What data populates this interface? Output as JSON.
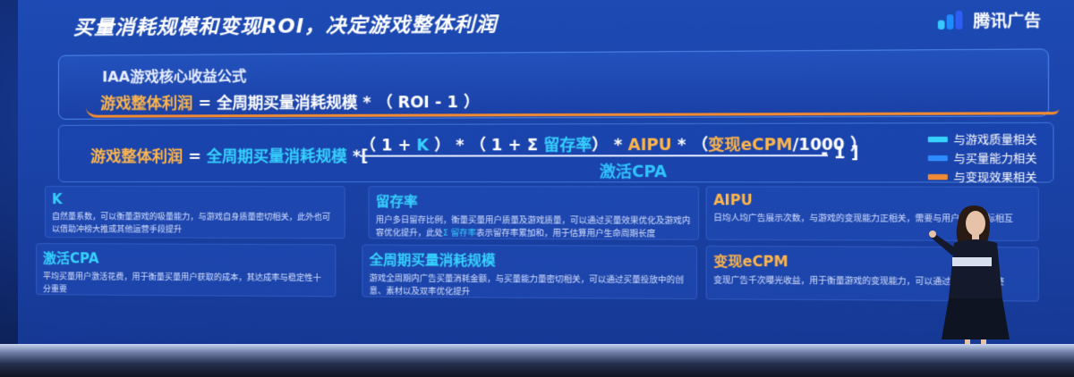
{
  "slide": {
    "title": "买量消耗规模和变现ROI，决定游戏整体利润",
    "brand_name": "腾讯广告",
    "brand_colors": [
      "#36c8ff",
      "#1f8bff",
      "#2f5ef2"
    ],
    "formula_box": {
      "heading": "IAA游戏核心收益公式",
      "lhs": "游戏整体利润",
      "rhs": "= 全周期买量消耗规模 * （ ROI - 1 ）"
    },
    "expanded_formula": {
      "lhs": "游戏整体利润",
      "eq": " = ",
      "scale": "全周期买量消耗规模",
      "open": " *[",
      "num_1": "（ 1 + ",
      "k": "K",
      "num_2": " ） * （ 1 + Σ ",
      "retention": "留存率",
      "num_3": "） * ",
      "aipu": "AIPU",
      "num_4": " * （",
      "ecpm": "变现eCPM",
      "num_5": "/1000 ）",
      "denominator": "激活CPA",
      "tail": "- 1 ]"
    },
    "legend": [
      {
        "label": "与游戏质量相关",
        "color": "#36d2ff"
      },
      {
        "label": "与买量能力相关",
        "color": "#2f8cff"
      },
      {
        "label": "与变现效果相关",
        "color": "#f08a33"
      }
    ],
    "cards": [
      {
        "title": "K",
        "text": "自然量系数，可以衡量游戏的吸量能力，与游戏自身质量密切相关，此外也可以借助冲榜大推或其他运营手段提升"
      },
      {
        "title": "留存率",
        "text_1": "用户多日留存比例，衡量买量用户质量及游戏质量，可以通过买量效果优化及游戏内容优化提升，此处",
        "highlight": "Σ 留存率",
        "text_2": "表示留存率累加和，用于估算用户生命周期长度"
      },
      {
        "title": "AIPU",
        "text": "日均人均广告展示次数，与游戏的变现能力正相关，需要与用户体验指标相互"
      },
      {
        "title": "激活CPA",
        "text": "平均买量用户激活花费，用于衡量买量用户获取的成本，其达成率与稳定性十分重要"
      },
      {
        "title": "全周期买量消耗规模",
        "text": "游戏全周期内广告买量消耗金额，与买量能力量密切相关，可以通过买量投放中的创意、素材以及双率优化提升"
      },
      {
        "title": "变现eCPM",
        "text": "变现广告千次曝光收益，用于衡量游戏的变现能力，可以通过广告类型调整"
      }
    ]
  }
}
